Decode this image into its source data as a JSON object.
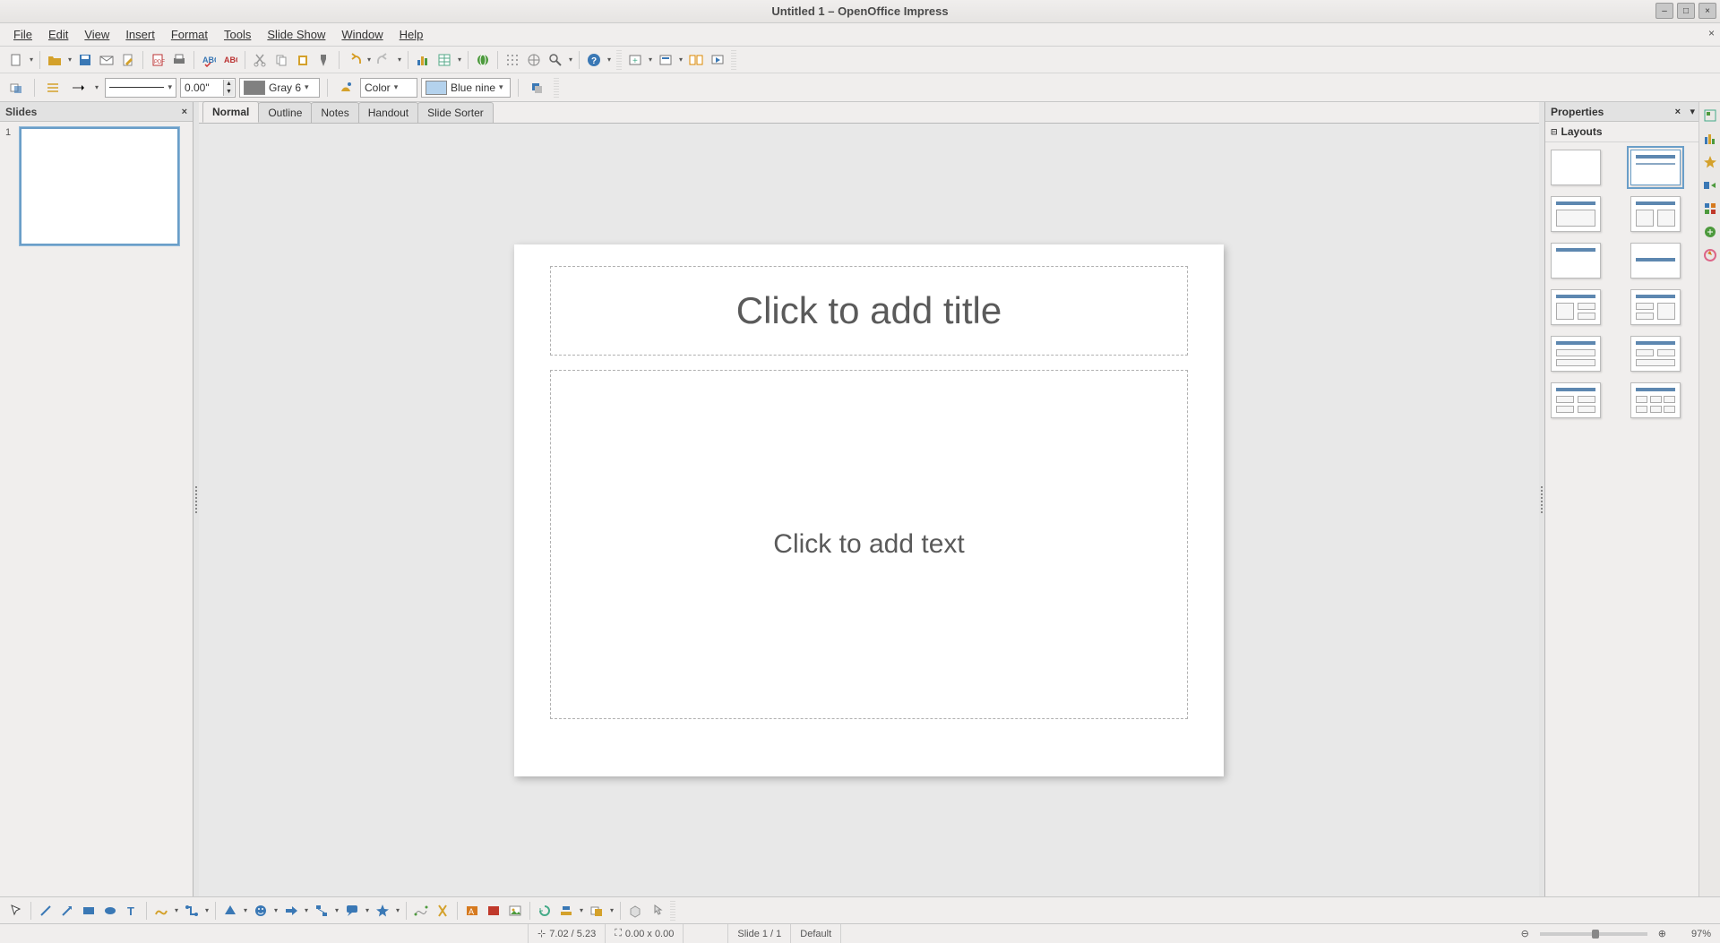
{
  "window": {
    "title": "Untitled 1 – OpenOffice Impress"
  },
  "menu": {
    "file": "File",
    "edit": "Edit",
    "view": "View",
    "insert": "Insert",
    "format": "Format",
    "tools": "Tools",
    "slideshow": "Slide Show",
    "window": "Window",
    "help": "Help"
  },
  "format_toolbar": {
    "line_width": "0.00\"",
    "line_color_name": "Gray 6",
    "line_color_hex": "#808080",
    "fill_type": "Color",
    "fill_name": "Blue nine",
    "fill_hex": "#b4d2ed"
  },
  "slides_panel": {
    "title": "Slides"
  },
  "view_tabs": {
    "normal": "Normal",
    "outline": "Outline",
    "notes": "Notes",
    "handout": "Handout",
    "slidesorter": "Slide Sorter"
  },
  "slide": {
    "title_placeholder": "Click to add title",
    "content_placeholder": "Click to add text"
  },
  "properties": {
    "title": "Properties",
    "layouts_label": "Layouts"
  },
  "status": {
    "pos": "7.02 / 5.23",
    "size": "0.00 x 0.00",
    "slide": "Slide 1 / 1",
    "master": "Default",
    "zoom": "97%"
  }
}
